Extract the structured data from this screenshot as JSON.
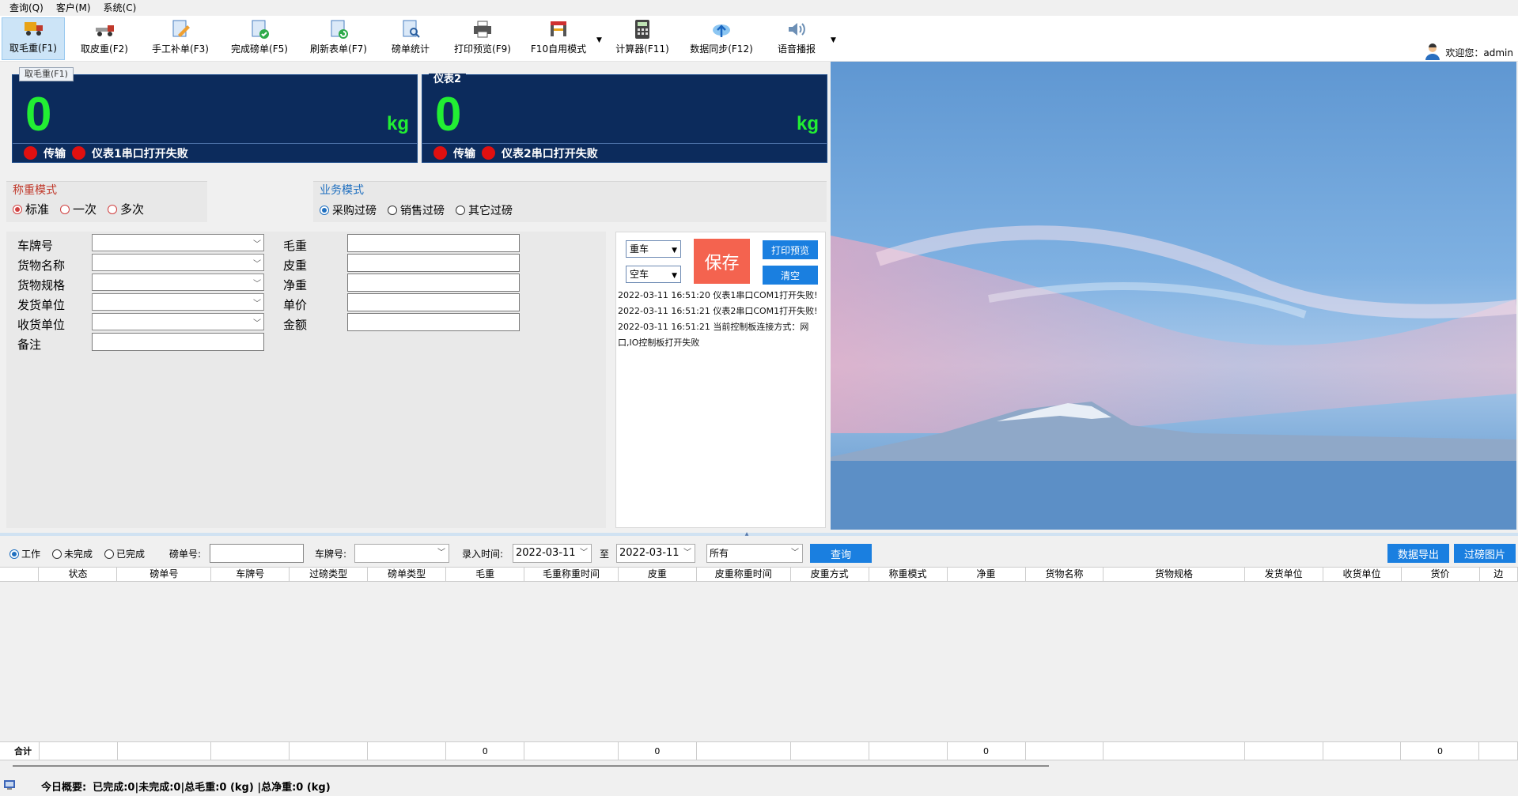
{
  "menu": [
    "查询(Q)",
    "客户(M)",
    "系统(C)"
  ],
  "toolbar": {
    "buttons": [
      "取毛重(F1)",
      "取皮重(F2)",
      "手工补单(F3)",
      "完成磅单(F5)",
      "刷新表单(F7)",
      "磅单统计",
      "打印预览(F9)",
      "F10自用模式",
      "计算器(F11)",
      "数据同步(F12)",
      "语音播报"
    ],
    "welcome": "欢迎您：admin"
  },
  "scale1": {
    "tag": "取毛重(F1)",
    "value": "0",
    "unit": "kg",
    "status1": "传输",
    "status2": "仪表1串口打开失败"
  },
  "scale2": {
    "tag": "仪表2",
    "value": "0",
    "unit": "kg",
    "status1": "传输",
    "status2": "仪表2串口打开失败"
  },
  "weigh_mode": {
    "legend": "称重模式",
    "options": [
      "标准",
      "一次",
      "多次"
    ],
    "selected": "标准"
  },
  "business_mode": {
    "legend": "业务模式",
    "options": [
      "采购过磅",
      "销售过磅",
      "其它过磅"
    ],
    "selected": "采购过磅"
  },
  "form": {
    "left_labels": [
      "车牌号",
      "货物名称",
      "货物规格",
      "发货单位",
      "收货单位",
      "备注"
    ],
    "right_labels": [
      "毛重",
      "皮重",
      "净重",
      "单价",
      "金额"
    ]
  },
  "control": {
    "car_state_1": "重车",
    "car_state_2": "空车",
    "save": "保存",
    "print_preview": "打印预览",
    "clear": "清空",
    "log": [
      "2022-03-11 16:51:20 仪表1串口COM1打开失败!",
      "2022-03-11 16:51:21 仪表2串口COM1打开失败!",
      "2022-03-11 16:51:21 当前控制板连接方式：网口,IO控制板打开失败"
    ]
  },
  "query": {
    "status_options": [
      "工作",
      "未完成",
      "已完成"
    ],
    "status_selected": "工作",
    "ticket_label": "磅单号:",
    "plate_label": "车牌号:",
    "time_label": "录入时间:",
    "date_from": "2022-03-11",
    "to_label": "至",
    "date_to": "2022-03-11",
    "filter": "所有",
    "search": "查询",
    "export": "数据导出",
    "filter_images": "过磅图片"
  },
  "grid": {
    "headers": [
      "",
      "状态",
      "磅单号",
      "车牌号",
      "过磅类型",
      "磅单类型",
      "毛重",
      "毛重称重时间",
      "皮重",
      "皮重称重时间",
      "皮重方式",
      "称重模式",
      "净重",
      "货物名称",
      "货物规格",
      "发货单位",
      "收货单位",
      "货价",
      "边"
    ],
    "totals": [
      "合计",
      "",
      "",
      "",
      "",
      "",
      "0",
      "",
      "0",
      "",
      "",
      "",
      "0",
      "",
      "",
      "",
      "",
      "0",
      ""
    ]
  },
  "status_bar": {
    "label": "今日概要:",
    "summary": "已完成:0|未完成:0|总毛重:0 (kg) |总净重:0 (kg)"
  }
}
